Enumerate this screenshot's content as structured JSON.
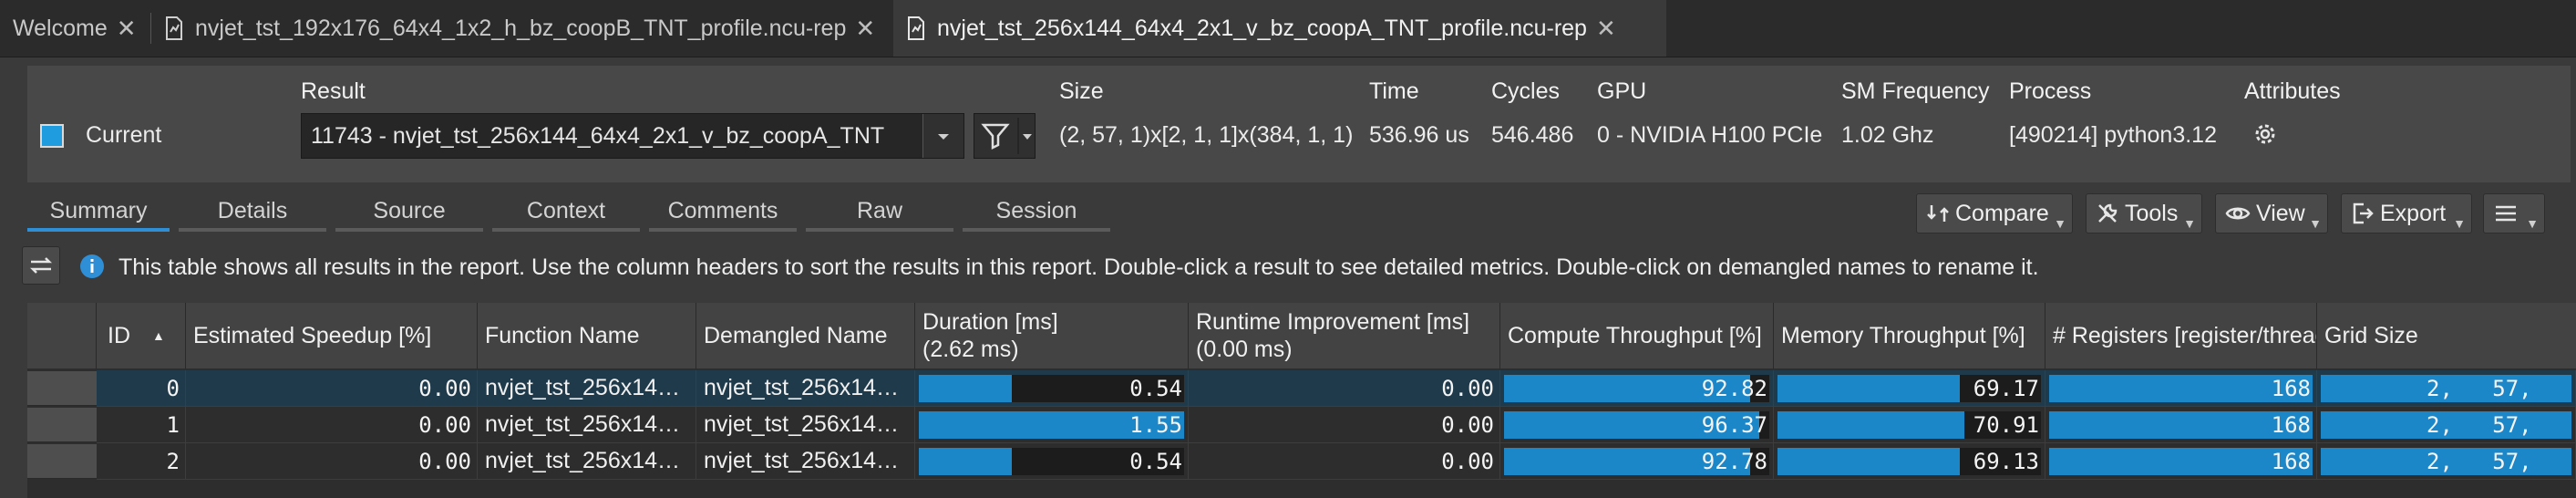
{
  "tabs": [
    {
      "label": "Welcome",
      "icon": "none"
    },
    {
      "label": "nvjet_tst_192x176_64x4_1x2_h_bz_coopB_TNT_profile.ncu-rep",
      "icon": "report-file-icon"
    },
    {
      "label": "nvjet_tst_256x144_64x4_2x1_v_bz_coopA_TNT_profile.ncu-rep",
      "icon": "report-file-icon"
    }
  ],
  "header": {
    "labels": {
      "result": "Result",
      "size": "Size",
      "time": "Time",
      "cycles": "Cycles",
      "gpu": "GPU",
      "sm_frequency": "SM Frequency",
      "process": "Process",
      "attributes": "Attributes"
    },
    "current_label": "Current",
    "result_value": "11743 - nvjet_tst_256x144_64x4_2x1_v_bz_coopA_TNT",
    "size_value": "(2, 57, 1)x[2, 1, 1]x(384, 1, 1)",
    "time_value": "536.96 us",
    "cycles_value": "546.486",
    "gpu_value": "0 - NVIDIA H100 PCIe",
    "sm_frequency_value": "1.02 Ghz",
    "process_value": "[490214] python3.12",
    "accent_color": "#1f9be0"
  },
  "section_tabs": [
    "Summary",
    "Details",
    "Source",
    "Context",
    "Comments",
    "Raw",
    "Session"
  ],
  "toolbar": {
    "compare": "Compare",
    "tools": "Tools",
    "view": "View",
    "export": "Export"
  },
  "info_text": "This table shows all results in the report. Use the column headers to sort the results in this report. Double-click a result to see detailed metrics. Double-click on demangled names to rename it.",
  "table": {
    "columns": {
      "id": "ID",
      "speedup": "Estimated Speedup [%]",
      "function": "Function Name",
      "demangled": "Demangled Name",
      "duration": "Duration [ms]",
      "duration_sub": "(2.62 ms)",
      "runtime": "Runtime Improvement [ms]",
      "runtime_sub": "(0.00 ms)",
      "compute": "Compute Throughput [%]",
      "memory": "Memory Throughput [%]",
      "registers": "# Registers [register/thread]",
      "grid": "Grid Size"
    },
    "rows": [
      {
        "id": "0",
        "speedup": "0.00",
        "function": "nvjet_tst_256x14…",
        "demangled": "nvjet_tst_256x14…",
        "duration": "0.54",
        "duration_frac": 0.35,
        "runtime": "0.00",
        "compute": "92.82",
        "compute_frac": 0.9282,
        "memory": "69.17",
        "memory_frac": 0.6917,
        "registers": "168",
        "grid": "2,   57,"
      },
      {
        "id": "1",
        "speedup": "0.00",
        "function": "nvjet_tst_256x14…",
        "demangled": "nvjet_tst_256x14…",
        "duration": "1.55",
        "duration_frac": 1.0,
        "runtime": "0.00",
        "compute": "96.37",
        "compute_frac": 0.9637,
        "memory": "70.91",
        "memory_frac": 0.7091,
        "registers": "168",
        "grid": "2,   57,"
      },
      {
        "id": "2",
        "speedup": "0.00",
        "function": "nvjet_tst_256x14…",
        "demangled": "nvjet_tst_256x14…",
        "duration": "0.54",
        "duration_frac": 0.35,
        "runtime": "0.00",
        "compute": "92.78",
        "compute_frac": 0.9278,
        "memory": "69.13",
        "memory_frac": 0.6913,
        "registers": "168",
        "grid": "2,   57,"
      }
    ]
  }
}
